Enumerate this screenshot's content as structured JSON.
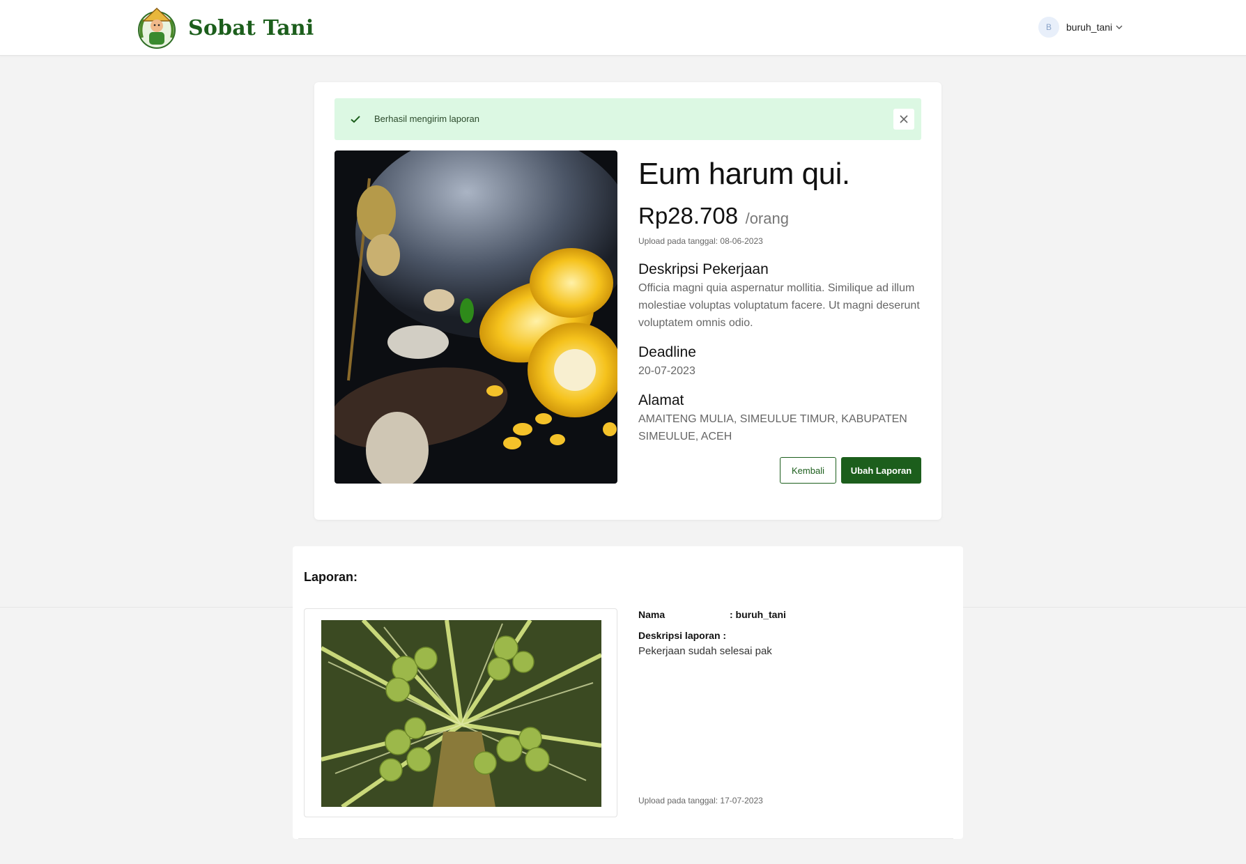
{
  "header": {
    "brand": "Sobat Tani",
    "avatar_initial": "B",
    "username": "buruh_tani"
  },
  "alert": {
    "message": "Berhasil mengirim laporan"
  },
  "job": {
    "title": "Eum harum qui.",
    "price": "Rp28.708",
    "per_unit": "/orang",
    "upload_date": "Upload pada tanggal: 08-06-2023",
    "description_label": "Deskripsi Pekerjaan",
    "description": "Officia magni quia aspernatur mollitia. Similique ad illum molestiae voluptas voluptatum facere. Ut magni deserunt voluptatem omnis odio.",
    "deadline_label": "Deadline",
    "deadline": "20-07-2023",
    "address_label": "Alamat",
    "address": "AMAITENG MULIA, SIMEULUE TIMUR, KABUPATEN SIMEULUE, ACEH",
    "back_label": "Kembali",
    "edit_label": "Ubah Laporan"
  },
  "report": {
    "heading": "Laporan:",
    "name_label": "Nama",
    "name_value": ": buruh_tani",
    "desc_label": "Deskripsi laporan :",
    "desc_value": "Pekerjaan sudah selesai pak",
    "upload_date": "Upload pada tanggal: 17-07-2023"
  },
  "colors": {
    "primary": "#1c5e1c",
    "alert_bg": "#dcf8e3",
    "page_bg": "#f3f3f3"
  },
  "icons": [
    "farmer-logo-icon",
    "chevron-down-icon",
    "check-icon",
    "close-icon"
  ]
}
